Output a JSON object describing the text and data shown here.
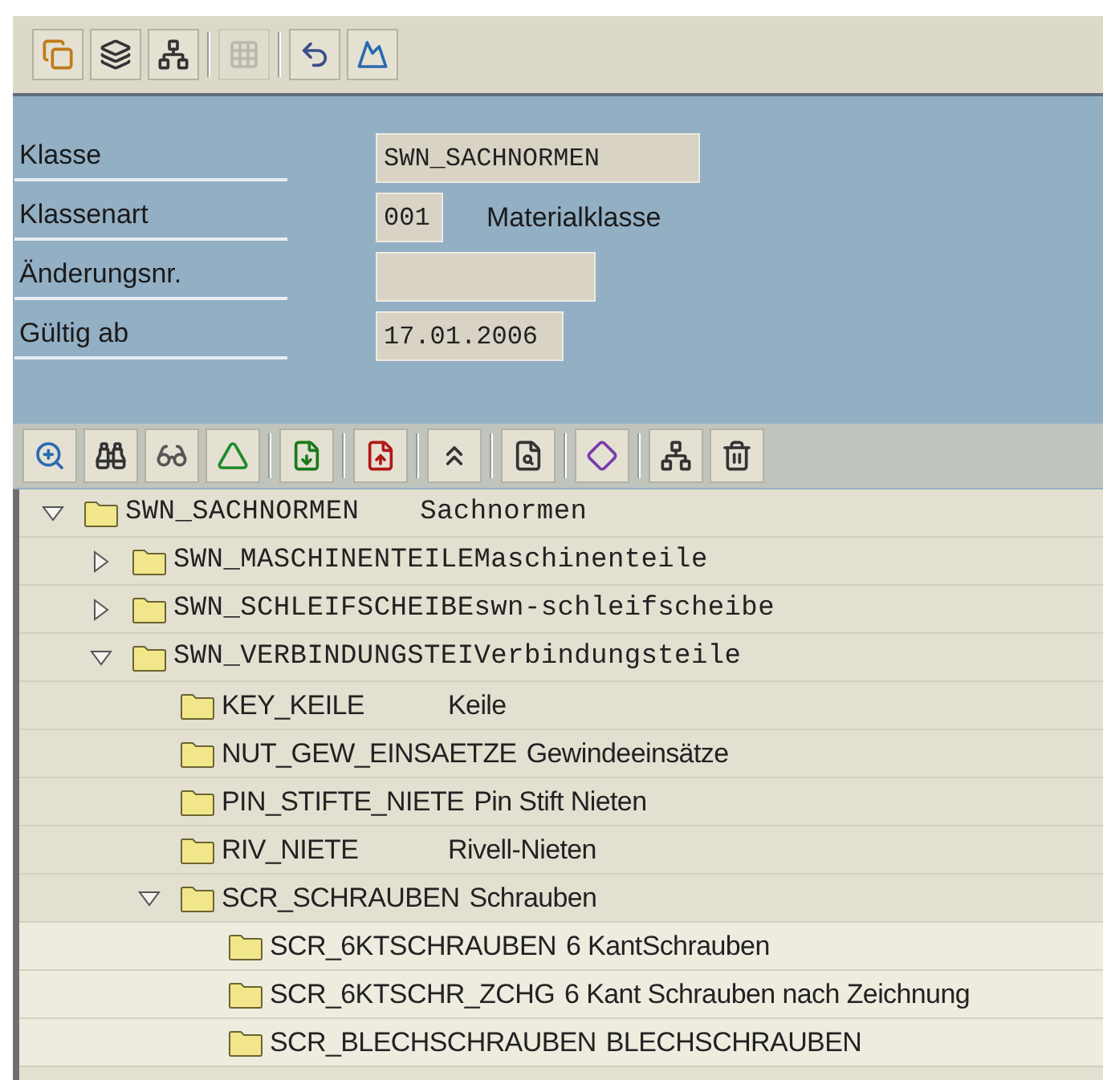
{
  "toolbar": {
    "groups": [
      {
        "buttons": [
          {
            "disabled": false
          },
          {
            "disabled": false
          },
          {
            "disabled": false
          }
        ]
      },
      {
        "buttons": [
          {
            "disabled": true
          }
        ]
      },
      {
        "buttons": [
          {
            "disabled": false
          },
          {
            "disabled": false
          }
        ]
      }
    ]
  },
  "header": {
    "fields": [
      {
        "label": "Klasse",
        "value": "SWN_SACHNORMEN"
      },
      {
        "label": "Klassenart",
        "value": "001",
        "description": "Materialklasse"
      },
      {
        "label": "Änderungsnr."
      },
      {
        "label": "Gültig ab",
        "value": "17.01.2006"
      }
    ]
  },
  "tree_toolbar": {
    "groups": [
      {
        "buttons": [
          {
            "disabled": false
          },
          {
            "disabled": false
          },
          {
            "disabled": false
          },
          {
            "disabled": false
          }
        ]
      },
      {
        "buttons": [
          {
            "disabled": false
          }
        ]
      },
      {
        "buttons": [
          {
            "disabled": false
          }
        ]
      },
      {
        "buttons": [
          {
            "disabled": false
          }
        ]
      },
      {
        "buttons": [
          {
            "disabled": false
          }
        ]
      },
      {
        "buttons": [
          {
            "disabled": false
          }
        ]
      },
      {
        "buttons": [
          {
            "disabled": false
          },
          {
            "disabled": false
          }
        ]
      }
    ]
  },
  "tree": [
    {
      "key": "SWN_SACHNORMEN",
      "text": "Sachnormen",
      "expanded": true,
      "children": [
        {
          "key": "SWN_MASCHINENTEILE",
          "text": "Maschinenteile",
          "expanded": false
        },
        {
          "key": "SWN_SCHLEIFSCHEIBE",
          "text": "swn-schleifscheibe",
          "expanded": false
        },
        {
          "key": "SWN_VERBINDUNGSTEI",
          "text": "Verbindungsteile",
          "expanded": true,
          "children": [
            {
              "key": "KEY_KEILE",
              "text": "Keile"
            },
            {
              "key": "NUT_GEW_EINSAETZE",
              "text": "Gewindeeinsätze"
            },
            {
              "key": "PIN_STIFTE_NIETE",
              "text": "Pin Stift Nieten"
            },
            {
              "key": "RIV_NIETE",
              "text": "Rivell-Nieten"
            },
            {
              "key": "SCR_SCHRAUBEN",
              "text": "Schrauben",
              "expanded": true,
              "children": [
                {
                  "key": "SCR_6KTSCHRAUBEN",
                  "text": "6 KantSchrauben"
                },
                {
                  "key": "SCR_6KTSCHR_ZCHG",
                  "text": "6 Kant Schrauben nach Zeichnung"
                },
                {
                  "key": "SCR_BLECHSCHRAUBEN",
                  "text": "BLECHSCHRAUBEN"
                }
              ]
            }
          ]
        }
      ]
    }
  ]
}
